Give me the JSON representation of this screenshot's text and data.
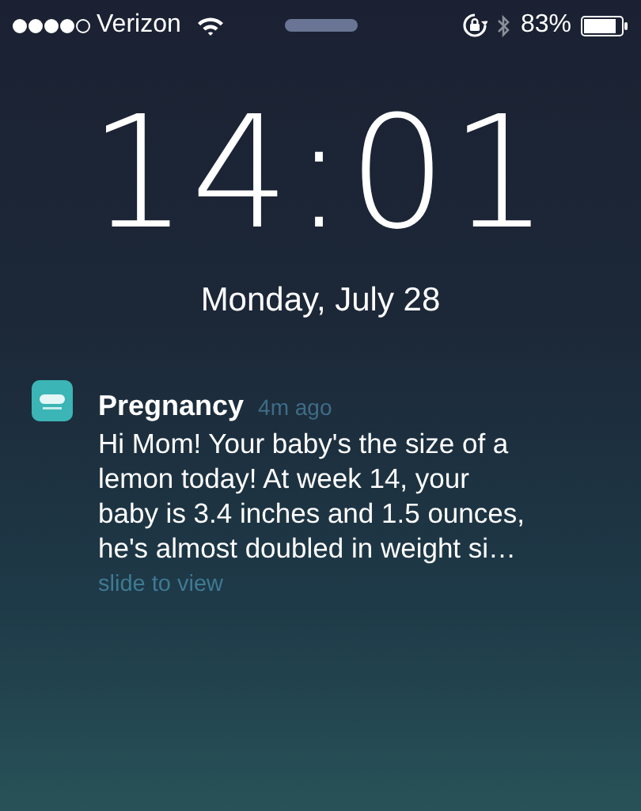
{
  "status_bar": {
    "carrier": "Verizon",
    "battery": "83%"
  },
  "clock": {
    "time": "14:01",
    "date": "Monday, July 28"
  },
  "notification": {
    "app": "Pregnancy",
    "age": "4m ago",
    "message_lines": [
      "Hi Mom! Your baby's the size of a",
      "lemon today! At week 14, your",
      "baby is 3.4 inches and 1.5 ounces,",
      "he's almost doubled in weight si…"
    ],
    "action": "slide to view"
  }
}
